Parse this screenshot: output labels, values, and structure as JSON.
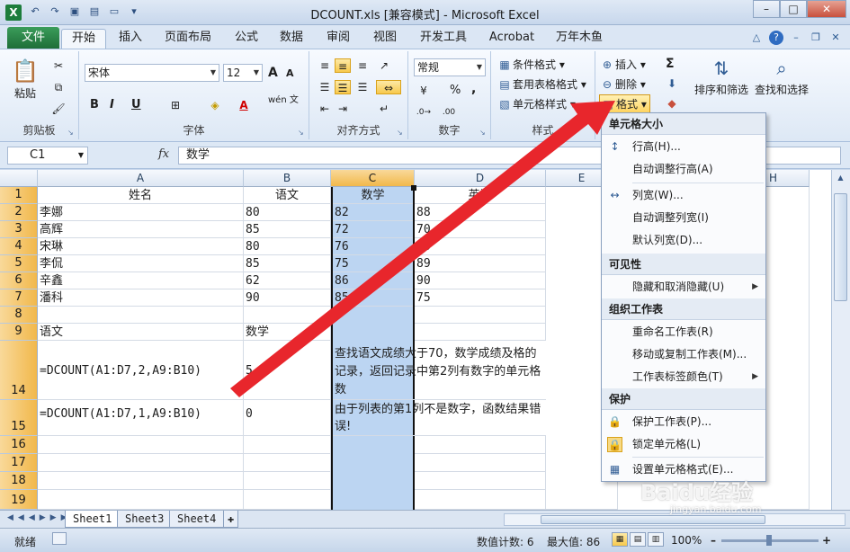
{
  "window": {
    "title": "DCOUNT.xls  [兼容模式] - Microsoft Excel",
    "app_icon": "X",
    "controls": {
      "minimize": "–",
      "maximize": "□",
      "close": "✕"
    }
  },
  "ribbon_tabs": {
    "file": "文件",
    "items": [
      "开始",
      "插入",
      "页面布局",
      "公式",
      "数据",
      "审阅",
      "视图",
      "开发工具",
      "Acrobat",
      "万年木鱼"
    ],
    "active": "开始"
  },
  "ribbon": {
    "clipboard": {
      "paste": "粘贴",
      "label": "剪贴板"
    },
    "font": {
      "name": "宋体",
      "size": "12",
      "bold": "B",
      "italic": "I",
      "underline": "U",
      "grow": "A",
      "shrink": "A",
      "label": "字体",
      "wen": "wén 文"
    },
    "alignment": {
      "label": "对齐方式"
    },
    "number": {
      "format": "常规",
      "percent": "%",
      "comma": ",",
      "label": "数字"
    },
    "styles": {
      "conditional": "条件格式",
      "table": "套用表格格式",
      "cell": "单元格样式",
      "label": "样式"
    },
    "cells": {
      "insert": "插入",
      "delete": "删除",
      "format": "格式"
    },
    "editing": {
      "sum": "Σ",
      "sort": "排序和筛选",
      "find": "查找和选择"
    }
  },
  "formula_bar": {
    "name_box": "C1",
    "fx": "fx",
    "formula": "数学"
  },
  "columns": [
    "A",
    "B",
    "C",
    "D",
    "E",
    "H"
  ],
  "rows": [
    "1",
    "2",
    "3",
    "4",
    "5",
    "6",
    "7",
    "8",
    "9",
    "14",
    "15",
    "16",
    "17",
    "18",
    "19"
  ],
  "cells": {
    "r1": [
      "姓名",
      "语文",
      "数学",
      "英语"
    ],
    "r2": [
      "李娜",
      "80",
      "82",
      "88"
    ],
    "r3": [
      "高辉",
      "85",
      "72",
      "70"
    ],
    "r4": [
      "宋琳",
      "80",
      "76",
      "83"
    ],
    "r5": [
      "李侃",
      "85",
      "75",
      "89"
    ],
    "r6": [
      "辛鑫",
      "62",
      "86",
      "90"
    ],
    "r7": [
      "潘科",
      "90",
      "85",
      "75"
    ],
    "r9": [
      "语文",
      "数学"
    ],
    "r14": [
      "=DCOUNT(A1:D7,2,A9:B10)",
      "5",
      "查找语文成绩大于70，数学成绩及格的记录，返回记录中第2列有数字的单元格数"
    ],
    "r15": [
      "=DCOUNT(A1:D7,1,A9:B10)",
      "0",
      "由于列表的第1列不是数字，函数结果错误!"
    ]
  },
  "sheets": [
    "Sheet1",
    "Sheet3",
    "Sheet4"
  ],
  "active_sheet": "Sheet1",
  "status": {
    "ready": "就绪",
    "count": "数值计数: 6",
    "max": "最大值: 86",
    "zoom": "100%"
  },
  "format_menu": {
    "sections": {
      "size": "单元格大小",
      "visibility": "可见性",
      "organize": "组织工作表",
      "protect": "保护"
    },
    "items": {
      "row_height": "行高(H)...",
      "autofit_row": "自动调整行高(A)",
      "col_width": "列宽(W)...",
      "autofit_col": "自动调整列宽(I)",
      "default_width": "默认列宽(D)...",
      "hide_unhide": "隐藏和取消隐藏(U)",
      "rename": "重命名工作表(R)",
      "move_copy": "移动或复制工作表(M)...",
      "tab_color": "工作表标签颜色(T)",
      "protect_sheet": "保护工作表(P)...",
      "lock_cell": "锁定单元格(L)",
      "format_cells": "设置单元格格式(E)..."
    }
  },
  "watermark": {
    "brand": "Baidu经验",
    "url": "jingyan.baidu.com"
  },
  "colors": {
    "file_tab": "#1e6e38",
    "selection": "#bcd5f2",
    "arrow": "#e8262c",
    "header_highlight": "#f1b84b"
  }
}
